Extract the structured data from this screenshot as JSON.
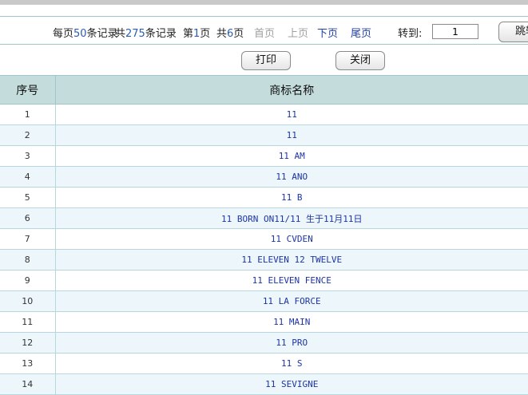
{
  "pager": {
    "per_page_prefix": "每页",
    "per_page": "50",
    "per_page_suffix": "条记录",
    "total_prefix": "共",
    "total": "275",
    "total_suffix": "条记录",
    "page_prefix": "第",
    "page": "1",
    "page_suffix": "页",
    "pages_prefix": "共",
    "pages": "6",
    "pages_suffix": "页",
    "first": "首页",
    "prev": "上页",
    "next": "下页",
    "last": "尾页",
    "goto_label": "转到:",
    "goto_value": "1",
    "goto_button": "跳转"
  },
  "actions": {
    "print": "打印",
    "close": "关闭"
  },
  "table": {
    "headers": [
      "序号",
      "商标名称"
    ],
    "rows": [
      [
        "1",
        "11"
      ],
      [
        "2",
        "11"
      ],
      [
        "3",
        "11 AM"
      ],
      [
        "4",
        "11 ANO"
      ],
      [
        "5",
        "11 B"
      ],
      [
        "6",
        "11 BORN ON11/11 生于11月11日"
      ],
      [
        "7",
        "11 CVDEN"
      ],
      [
        "8",
        "11 ELEVEN 12 TWELVE"
      ],
      [
        "9",
        "11 ELEVEN FENCE"
      ],
      [
        "10",
        "11 LA FORCE"
      ],
      [
        "11",
        "11 MAIN"
      ],
      [
        "12",
        "11 PRO"
      ],
      [
        "13",
        "11 S"
      ],
      [
        "14",
        "11 SEVIGNE"
      ]
    ]
  },
  "colors": {
    "header_bg": "#c4dcdc",
    "alt_row_bg": "#edf6fb",
    "link": "#1f3fa8",
    "border": "#9fc6cf"
  }
}
